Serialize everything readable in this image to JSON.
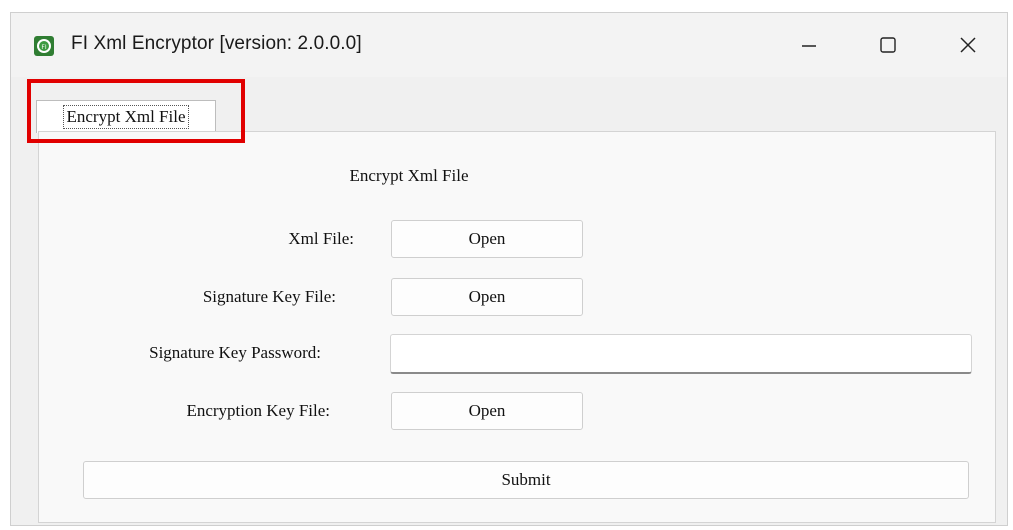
{
  "window": {
    "title": "FI Xml Encryptor [version: 2.0.0.0]",
    "controls": {
      "minimize": "minimize-icon",
      "maximize": "maximize-icon",
      "close": "close-icon"
    }
  },
  "tabs": [
    {
      "label": "Encrypt Xml File",
      "selected": true
    }
  ],
  "form": {
    "heading": "Encrypt Xml File",
    "xml_file_label": "Xml File:",
    "xml_file_button": "Open",
    "signature_key_file_label": "Signature Key File:",
    "signature_key_file_button": "Open",
    "signature_key_password_label": "Signature Key Password:",
    "signature_key_password_value": "",
    "encryption_key_file_label": "Encryption Key File:",
    "encryption_key_file_button": "Open",
    "submit_label": "Submit"
  },
  "colors": {
    "highlight": "#e10000",
    "window_bg": "#f0f0f0",
    "panel_bg": "#f9f9f9"
  }
}
